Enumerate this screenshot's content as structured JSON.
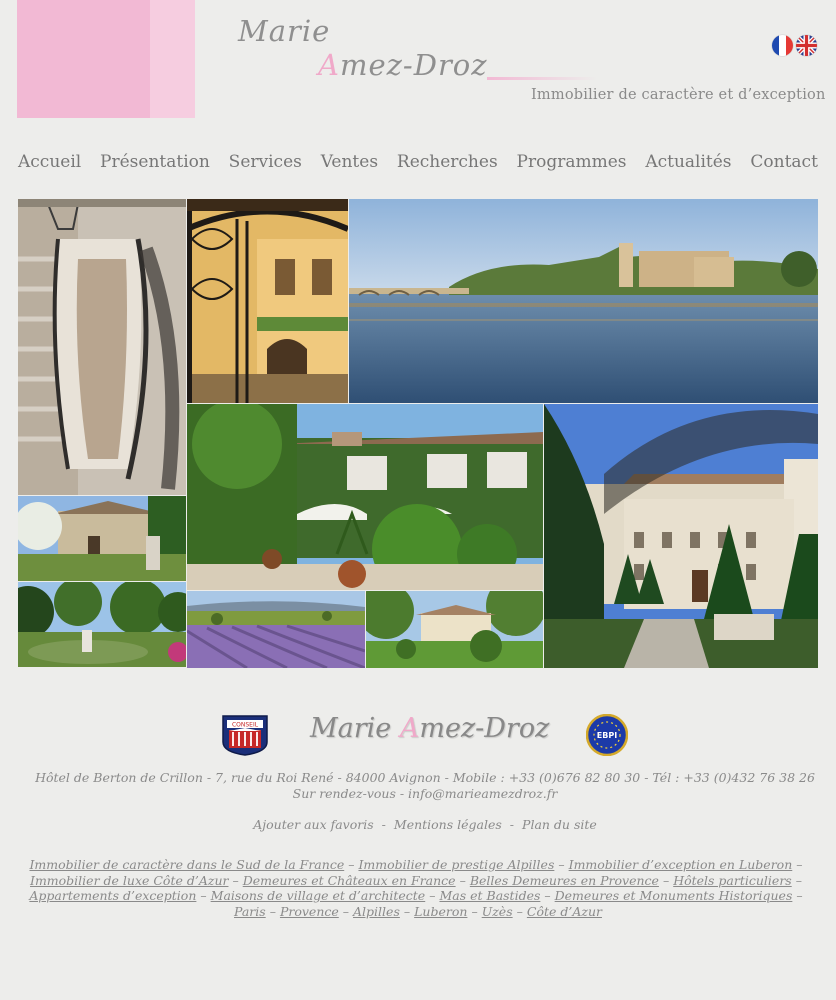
{
  "brand": {
    "first_name": "Marie",
    "last_name_initial": "A",
    "last_name_rest": "mez-Droz",
    "tagline": "Immobilier de caractère et d’exception",
    "pink_light": "#f6cde0",
    "pink": "#f2b9d4",
    "accent_pink": "#f0a9c9"
  },
  "languages": [
    {
      "icon": "flag-france-icon",
      "label": "Français"
    },
    {
      "icon": "flag-uk-icon",
      "label": "English"
    }
  ],
  "nav": {
    "items": [
      {
        "label": "Accueil"
      },
      {
        "label": "Présentation"
      },
      {
        "label": "Services"
      },
      {
        "label": "Ventes"
      },
      {
        "label": "Recherches"
      },
      {
        "label": "Programmes"
      },
      {
        "label": "Actualités"
      },
      {
        "label": "Contact"
      }
    ]
  },
  "gallery": {
    "photos": [
      {
        "name": "photo-staircase"
      },
      {
        "name": "photo-wrought-iron-gate"
      },
      {
        "name": "photo-avignon-rhone"
      },
      {
        "name": "photo-ivy-manor"
      },
      {
        "name": "photo-chateau"
      },
      {
        "name": "photo-stone-house"
      },
      {
        "name": "photo-garden-fountain"
      },
      {
        "name": "photo-lavender-field"
      },
      {
        "name": "photo-villa-garden"
      }
    ]
  },
  "footer": {
    "badges": {
      "conseil": "CONSEIL",
      "ebpi": "EBPI"
    },
    "address": "Hôtel de Berton de Crillon -  7, rue du Roi René - 84000 Avignon - Mobile : +33 (0)676 82 80 30 - Tél : +33 (0)432 76 38 26",
    "contact": "Sur rendez-vous - info@marieamezdroz.fr",
    "links": {
      "favorites": "Ajouter aux favoris",
      "legal": "Mentions légales",
      "sitemap": "Plan du site",
      "separator": "-"
    },
    "seo_links": [
      "Immobilier de caractère dans le Sud de la France",
      "Immobilier de prestige Alpilles",
      "Immobilier d’exception  en Luberon",
      "Immobilier de luxe Côte d’Azur",
      "Demeures et Châteaux en France",
      "Belles Demeures en Provence",
      "Hôtels particuliers",
      "Appartements d’exception",
      "Maisons de village et d’architecte",
      "Mas et Bastides",
      "Demeures et Monuments Historiques",
      "Paris",
      "Provence",
      "Alpilles",
      "Luberon",
      "Uzès",
      "Côte d’Azur"
    ],
    "seo_separator": "–"
  }
}
